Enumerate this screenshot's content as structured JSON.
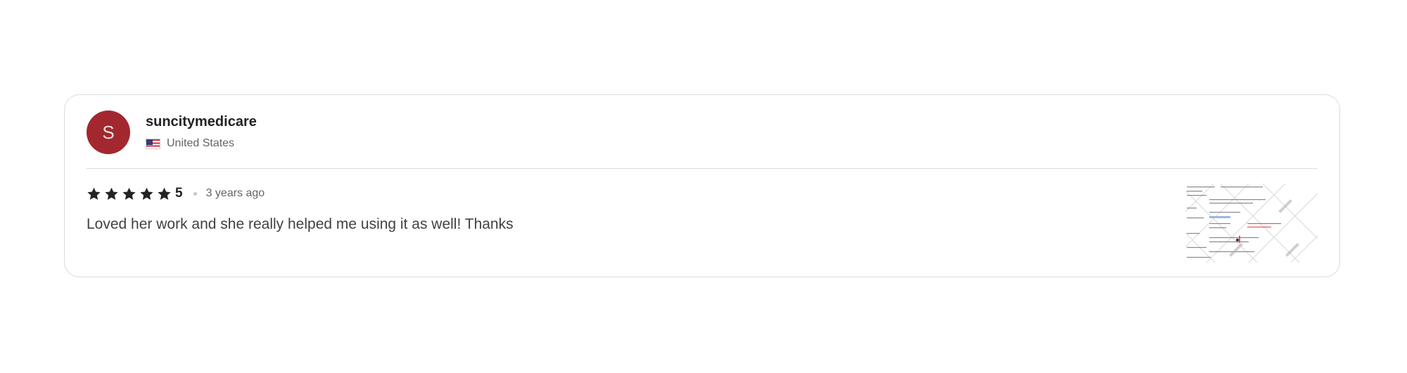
{
  "review": {
    "avatar_initial": "S",
    "avatar_color": "#a3272e",
    "username": "suncitymedicare",
    "country": "United States",
    "flag_icon": "us-flag-icon",
    "rating_value": "5",
    "rating_stars": 5,
    "time_ago": "3 years ago",
    "text": "Loved her work and she really helped me using it as well! Thanks",
    "attachment": "delivery-image-thumbnail"
  }
}
